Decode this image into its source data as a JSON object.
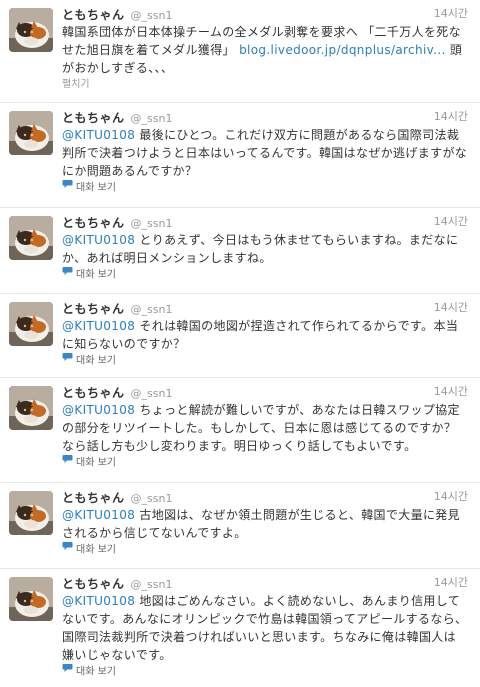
{
  "tweets": [
    {
      "fullname": "ともちゃん",
      "screen_name": "@_ssn1",
      "time": "14시간",
      "text": "韓国系団体が日本体操チームの全メダル剥奪を要求へ 「二千万人を死なせた旭日旗を着てメダル獲得」 ",
      "link": "blog.livedoor.jp/dqnplus/archiv...",
      "text_after": " 頭がおかしすぎる、、、",
      "action": "펼치기"
    },
    {
      "fullname": "ともちゃん",
      "screen_name": "@_ssn1",
      "time": "14시간",
      "mention": "@KITU0108",
      "text": " 最後にひとつ。これだけ双方に問題があるなら国際司法裁判所で決着つけようと日本はいってるんです。韓国はなぜか逃げますがなにか問題あるんですか？",
      "action": "대화 보기"
    },
    {
      "fullname": "ともちゃん",
      "screen_name": "@_ssn1",
      "time": "14시간",
      "mention": "@KITU0108",
      "text": " とりあえず、今日はもう休ませてもらいますね。まだなにか、あれば明日メンションしますね。",
      "action": "대화 보기"
    },
    {
      "fullname": "ともちゃん",
      "screen_name": "@_ssn1",
      "time": "14시간",
      "mention": "@KITU0108",
      "text": " それは韓国の地図が捏造されて作られてるからです。本当に知らないのですか？",
      "action": "대화 보기"
    },
    {
      "fullname": "ともちゃん",
      "screen_name": "@_ssn1",
      "time": "14시간",
      "mention": "@KITU0108",
      "text": " ちょっと解読が難しいですが、あなたは日韓スワップ協定の部分をリツイートした。もしかして、日本に恩は感じてるのですか？なら話し方も少し変わります。明日ゆっくり話してもよいです。",
      "action": "대화 보기"
    },
    {
      "fullname": "ともちゃん",
      "screen_name": "@_ssn1",
      "time": "14시간",
      "mention": "@KITU0108",
      "text": " 古地図は、なぜか領土問題が生じると、韓国で大量に発見されるから信じてないんですよ。",
      "action": "대화 보기"
    },
    {
      "fullname": "ともちゃん",
      "screen_name": "@_ssn1",
      "time": "14시간",
      "mention": "@KITU0108",
      "text": " 地図はごめんなさい。よく読めないし、あんまり信用してないです。あんなにオリンピックで竹島は韓国領ってアピールするなら、国際司法裁判所で決着つければいいと思います。ちなみに俺は韓国人は嫌いじゃないです。",
      "action": "대화 보기"
    }
  ],
  "colors": {
    "link": "#2a7fbf",
    "meta": "#999999",
    "text": "#333333",
    "divider": "#e8e8e8"
  },
  "icons": {
    "avatar": "cat-avatar",
    "conversation": "speech-bubble-icon"
  }
}
